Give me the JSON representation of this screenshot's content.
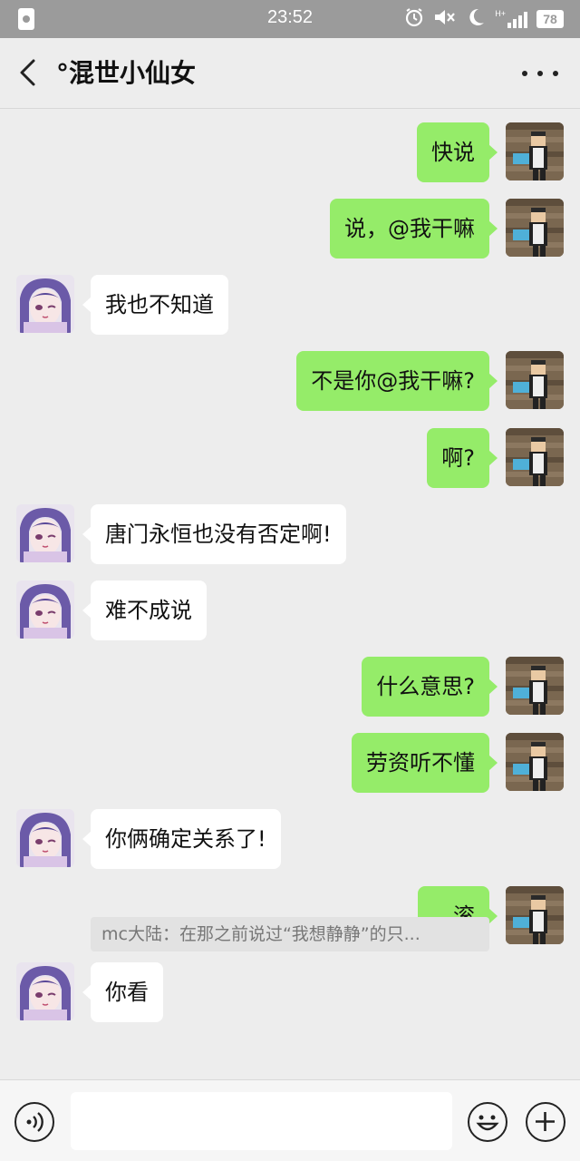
{
  "status_bar": {
    "time": "23:52",
    "network": "H+",
    "battery": "78",
    "icons": [
      "app-notification-icon",
      "alarm-icon",
      "mute-icon",
      "moon-icon",
      "signal-icon",
      "battery-icon"
    ]
  },
  "header": {
    "title": "°混世小仙女",
    "back_icon": "chevron-left-icon",
    "more_icon": "more-dots-icon"
  },
  "messages": [
    {
      "side": "out",
      "text": "快说"
    },
    {
      "side": "out",
      "text": "说，@我干嘛"
    },
    {
      "side": "in",
      "text": "我也不知道"
    },
    {
      "side": "out",
      "text": "不是你@我干嘛?"
    },
    {
      "side": "out",
      "text": "啊?"
    },
    {
      "side": "in",
      "text": "唐门永恒也没有否定啊!"
    },
    {
      "side": "in",
      "text": "难不成说"
    },
    {
      "side": "out",
      "text": "什么意思?"
    },
    {
      "side": "out",
      "text": "劳资听不懂"
    },
    {
      "side": "in",
      "text": "你俩确定关系了!"
    },
    {
      "side": "out",
      "text": "...滚"
    },
    {
      "side": "in",
      "text": "你看"
    }
  ],
  "quote": {
    "text": "mc大陆：在那之前说过“我想静静”的只..."
  },
  "input_bar": {
    "voice_icon": "voice-icon",
    "input_value": "",
    "emoji_icon": "emoji-icon",
    "plus_icon": "plus-icon"
  },
  "colors": {
    "outgoing_bubble": "#95ec69",
    "incoming_bubble": "#ffffff",
    "background": "#ededed",
    "status_bar": "#9b9b9b"
  }
}
